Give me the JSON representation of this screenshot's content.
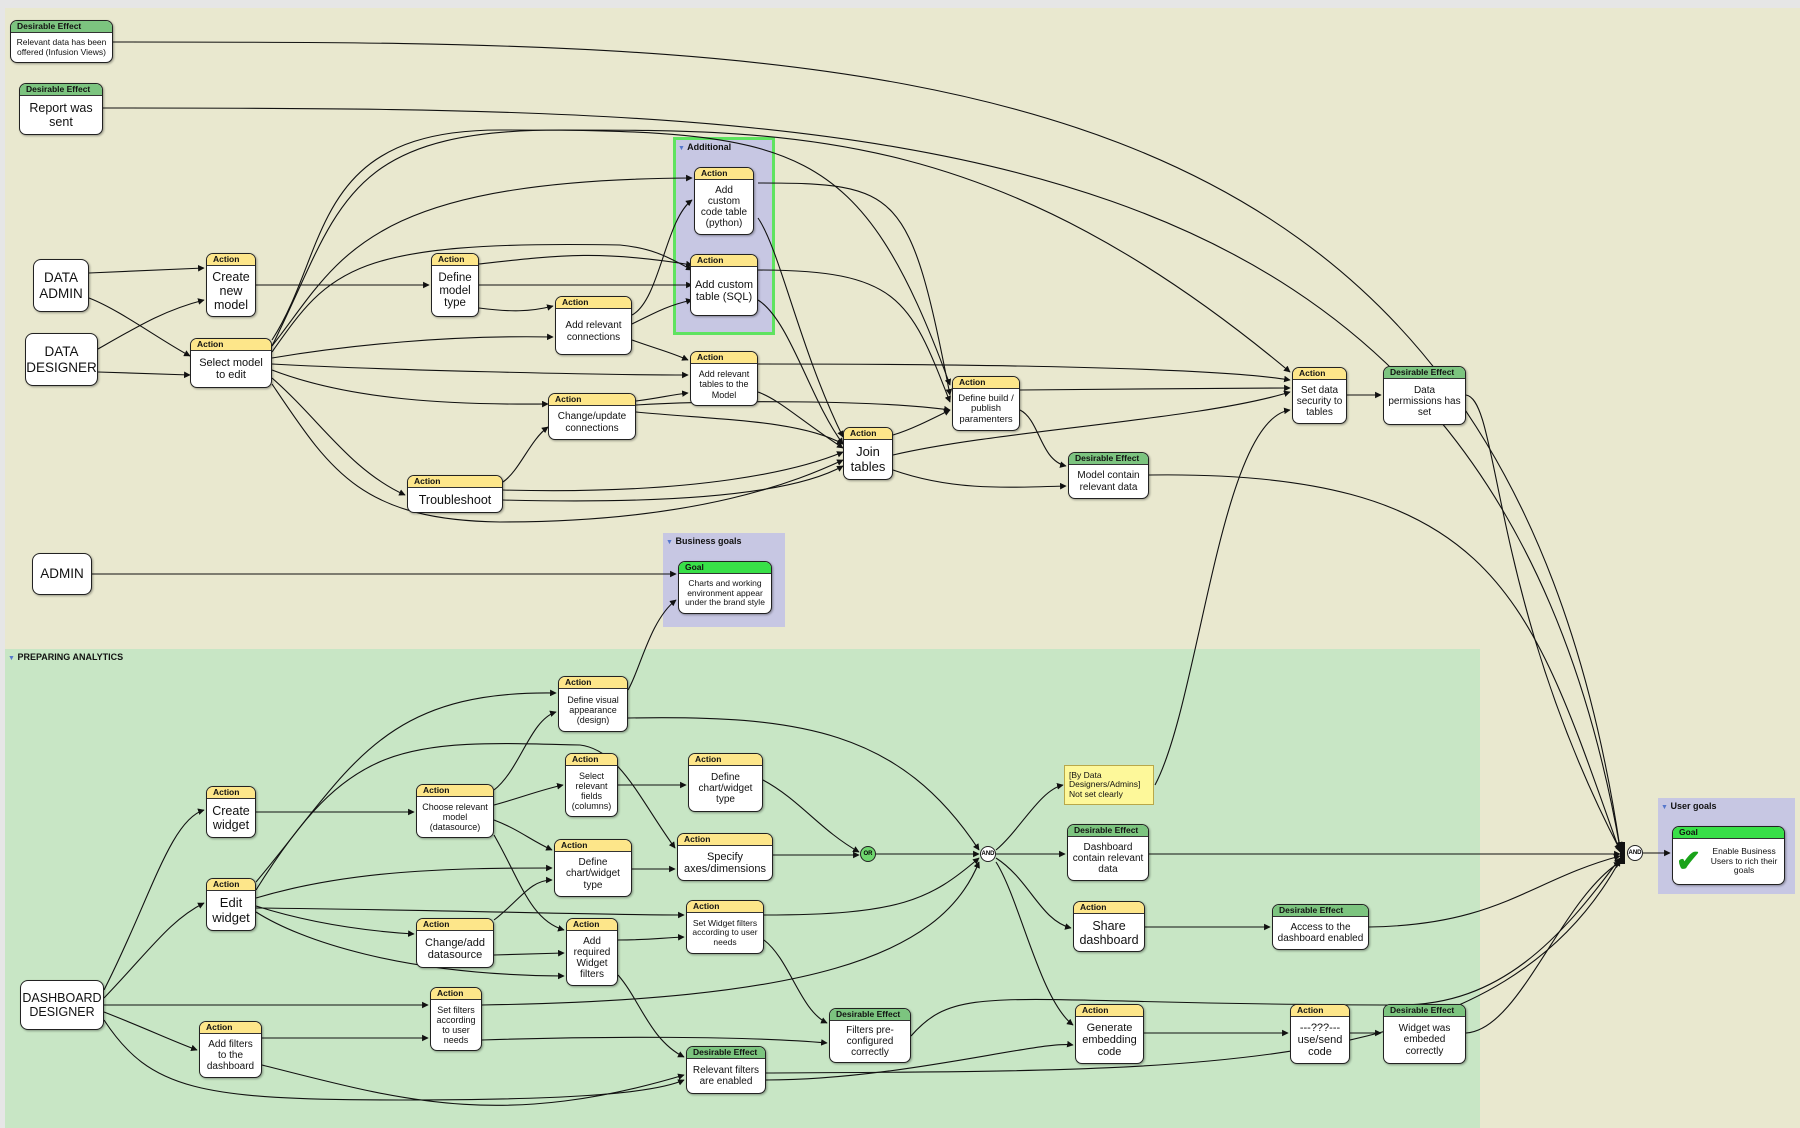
{
  "regions": {
    "additional": "Additional",
    "business_goals": "Business goals",
    "preparing_analytics": "PREPARING ANALYTICS",
    "user_goals": "User goals"
  },
  "headers": {
    "action": "Action",
    "effect": "Desirable Effect",
    "goal": "Goal"
  },
  "nodes": {
    "de_infusion": "Relevant data has been offered (Infusion Views)",
    "de_report": "Report was sent",
    "actor_data_admin": "DATA ADMIN",
    "actor_data_designer": "DATA DESIGNER",
    "actor_admin": "ADMIN",
    "actor_dashboard_designer": "DASHBOARD DESIGNER",
    "a_create_model": "Create new model",
    "a_select_model": "Select model to edit",
    "a_define_model_type": "Define model type",
    "a_add_rel_conn": "Add relevant connections",
    "a_change_conn": "Change/update connections",
    "a_troubleshoot": "Troubleshoot",
    "a_custom_python": "Add custom code table (python)",
    "a_custom_sql": "Add custom table (SQL)",
    "a_add_rel_tables": "Add relevant tables to the Model",
    "a_join_tables": "Join tables",
    "a_define_build": "Define build / publish paramenters",
    "de_model_contain": "Model contain relevant data",
    "a_set_security": "Set data security to tables",
    "de_permissions": "Data permissions has set",
    "g_brand": "Charts and working environment appear under the brand style",
    "a_create_widget": "Create widget",
    "a_edit_widget": "Edit widget",
    "a_add_filters_dash": "Add filters to the dashboard",
    "a_choose_model": "Choose relevant model (datasource)",
    "a_define_visual": "Define visual appearance (design)",
    "a_select_fields": "Select relevant fields (columns)",
    "a_define_chart1": "Define chart/widget type",
    "a_define_chart2": "Define chart/widget type",
    "a_specify_axes": "Specify axes/dimensions",
    "a_change_ds": "Change/add datasource",
    "a_add_req_filters": "Add required Widget filters",
    "a_set_widget_filters": "Set Widget filters according to user needs",
    "a_set_filters": "Set filters according to user needs",
    "de_filters_preconf": "Filters pre-configured correctly",
    "de_rel_filters": "Relevant filters are enabled",
    "note": "[By Data Designers/Admins] Not set clearly",
    "de_dash_contain": "Dashboard contain relevant data",
    "a_share_dash": "Share dashboard",
    "de_access": "Access to the dashboard enabled",
    "a_gen_embed": "Generate embedding code",
    "a_use_send": "---???--- use/send code",
    "de_widget_embed": "Widget was embeded correctly",
    "g_enable": "Enable Business Users to rich their goals"
  },
  "gates": {
    "or": "OR",
    "and": "AND"
  },
  "icons": {
    "goal_check": "check-icon",
    "collapse": "triangle-down-icon"
  },
  "colors": {
    "canvas_bg": "#e9e8cf",
    "analytics_bg": "#c8e6c5",
    "group_bg": "#c7c7e3",
    "additional_border": "#5fe35f",
    "action_header": "#fde68a",
    "effect_header": "#7cc47f",
    "goal_header": "#38e048"
  }
}
